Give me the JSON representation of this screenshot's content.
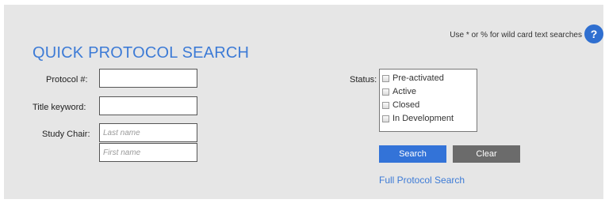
{
  "hint_text": "Use * or % for wild card text searches",
  "help_label": "?",
  "title": "QUICK PROTOCOL SEARCH",
  "fields": {
    "protocol_label": "Protocol #:",
    "protocol_value": "",
    "title_label": "Title keyword:",
    "title_value": "",
    "chair_label": "Study Chair:",
    "last_name_placeholder": "Last name",
    "first_name_placeholder": "First name"
  },
  "status": {
    "label": "Status:",
    "options": [
      "Pre-activated",
      "Active",
      "Closed",
      "In Development"
    ]
  },
  "buttons": {
    "search": "Search",
    "clear": "Clear"
  },
  "link_full": "Full Protocol Search"
}
